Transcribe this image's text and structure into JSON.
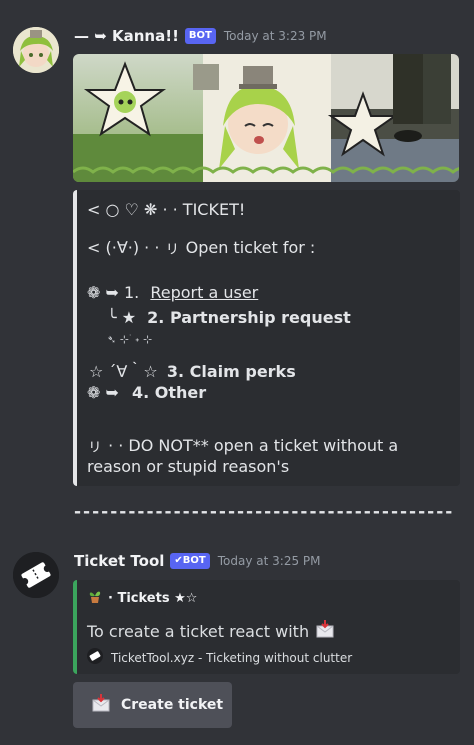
{
  "message1": {
    "username": "— ➥ Kanna!!",
    "bot_tag": "BOT",
    "timestamp": "Today at 3:23 PM",
    "embed_lines": {
      "line1": "<     ○    ♡    ❋  ·  · TICKET!",
      "line2": "< (·∀·)   ·    · ㇼ Open ticket for :",
      "opt1_prefix": "❁     ➥    1.",
      "opt1_link": "Report a user",
      "opt2_prefix": "╰  ★",
      "opt2_text": "2. Partnership request",
      "deco": "➴               ⊹ ࣪ ˖ ⊹",
      "opt3_prefix": "☆ ´∀｀☆",
      "opt3_text": "3. Claim perks",
      "opt4_prefix": "❁     ➥",
      "opt4_text": "4. Other",
      "warn1": "ㇼ  ·  · DO NOT** open a ticket without a",
      "warn2": "reason or stupid reason's"
    }
  },
  "divider": "------------------------------------------",
  "message2": {
    "username": "Ticket Tool",
    "bot_tag": "BOT",
    "bot_tag_check": "✔",
    "timestamp": "Today at 3:25 PM",
    "embed": {
      "title": "· Tickets ★☆",
      "title_icon": "plant-pot-icon",
      "description": "To create a ticket react with",
      "footer": "TicketTool.xyz - Ticketing without clutter"
    },
    "button_label": "Create ticket"
  },
  "colors": {
    "background": "#313338",
    "embed_bg": "#2b2d31",
    "bot_tag": "#5865f2",
    "embed_accent_green": "#3ba55d",
    "embed_accent_white": "#e5e6e8"
  }
}
